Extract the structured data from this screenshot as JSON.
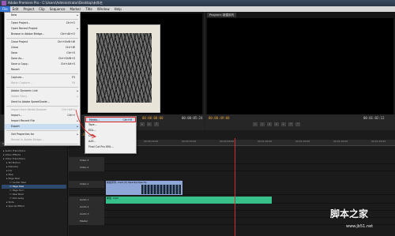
{
  "window": {
    "title": "Adobe Premiere Pro - C:\\Users\\Administrator\\Desktop\\未命名"
  },
  "menubar": {
    "items": [
      "File",
      "Edit",
      "Project",
      "Clip",
      "Sequence",
      "Marker",
      "Title",
      "Window",
      "Help"
    ]
  },
  "file_menu": {
    "items": [
      {
        "label": "New",
        "shortcut": "",
        "submenu": true,
        "disabled": false
      },
      {
        "label": "Open Project...",
        "shortcut": "Ctrl+O",
        "submenu": false,
        "disabled": false
      },
      {
        "label": "Open Recent Project",
        "shortcut": "",
        "submenu": true,
        "disabled": false
      },
      {
        "label": "Browse in Adobe Bridge...",
        "shortcut": "Ctrl+Alt+O",
        "submenu": false,
        "disabled": false
      },
      {
        "label": "Close Project",
        "shortcut": "Ctrl+Shift+W",
        "submenu": false,
        "disabled": false
      },
      {
        "label": "Close",
        "shortcut": "Ctrl+W",
        "submenu": false,
        "disabled": false
      },
      {
        "label": "Save",
        "shortcut": "Ctrl+S",
        "submenu": false,
        "disabled": false
      },
      {
        "label": "Save As...",
        "shortcut": "Ctrl+Shift+S",
        "submenu": false,
        "disabled": false
      },
      {
        "label": "Save a Copy...",
        "shortcut": "Ctrl+Alt+S",
        "submenu": false,
        "disabled": false
      },
      {
        "label": "Revert",
        "shortcut": "",
        "submenu": false,
        "disabled": false
      },
      {
        "label": "Capture...",
        "shortcut": "F5",
        "submenu": false,
        "disabled": false
      },
      {
        "label": "Batch Capture...",
        "shortcut": "F6",
        "submenu": false,
        "disabled": true
      },
      {
        "label": "Adobe Dynamic Link",
        "shortcut": "",
        "submenu": true,
        "disabled": false
      },
      {
        "label": "Adobe Story",
        "shortcut": "",
        "submenu": true,
        "disabled": true
      },
      {
        "label": "Send to Adobe SpeedGrade...",
        "shortcut": "",
        "submenu": false,
        "disabled": false
      },
      {
        "label": "Import from Media Browser",
        "shortcut": "Ctrl+Alt+I",
        "submenu": false,
        "disabled": true
      },
      {
        "label": "Import...",
        "shortcut": "Ctrl+I",
        "submenu": false,
        "disabled": false
      },
      {
        "label": "Import Recent File",
        "shortcut": "",
        "submenu": true,
        "disabled": false
      },
      {
        "label": "Export",
        "shortcut": "",
        "submenu": true,
        "disabled": false,
        "highlight": true
      },
      {
        "label": "Get Properties for",
        "shortcut": "",
        "submenu": true,
        "disabled": false
      },
      {
        "label": "Reveal in Adobe Bridge...",
        "shortcut": "",
        "submenu": false,
        "disabled": true
      },
      {
        "label": "Exit",
        "shortcut": "Ctrl+Q",
        "submenu": false,
        "disabled": false
      }
    ]
  },
  "export_submenu": {
    "items": [
      {
        "label": "Media...",
        "shortcut": "Ctrl+M",
        "highlight": true
      },
      {
        "label": "Tape...",
        "shortcut": ""
      },
      {
        "label": "EDL...",
        "shortcut": ""
      },
      {
        "label": "OMF...",
        "shortcut": ""
      },
      {
        "label": "AAF...",
        "shortcut": ""
      },
      {
        "label": "Final Cut Pro XML...",
        "shortcut": ""
      }
    ]
  },
  "source_monitor": {
    "timecode_left": "00:00:00:00",
    "timecode_right": "00:00:05:24"
  },
  "program_monitor": {
    "tab": "Program: 新建序列",
    "timecode_left": "00:00:49:08",
    "timecode_right": "00:01:02:12"
  },
  "project_panel": {
    "tabs": [
      "Media Browser",
      "Info",
      "Effects"
    ],
    "tree": [
      {
        "label": "Audio Transitions",
        "selected": false
      },
      {
        "label": "Video Effects",
        "selected": false
      },
      {
        "label": "Video Transitions",
        "selected": false
      },
      {
        "label": "3D Motion",
        "selected": false
      },
      {
        "label": "Dissolve",
        "selected": false
      },
      {
        "label": "Iris",
        "selected": false
      },
      {
        "label": "Map",
        "selected": false
      },
      {
        "label": "Page Peel",
        "selected": false
      },
      {
        "label": "Center Peel",
        "selected": false
      },
      {
        "label": "Page Peel",
        "selected": true
      },
      {
        "label": "Page Turn",
        "selected": false
      },
      {
        "label": "Peel Back",
        "selected": false
      },
      {
        "label": "Roll Away",
        "selected": false
      },
      {
        "label": "Slide",
        "selected": false
      },
      {
        "label": "Special Effect",
        "selected": false
      }
    ]
  },
  "timeline": {
    "timecode": "00:00:49:08",
    "ruler": [
      "00:00",
      "00:00:16:00",
      "00:00:32:00",
      "00:00:48:00",
      "00:01:04:00",
      "00:01:20:00",
      "00:01:36:00",
      "00:01:52:00"
    ],
    "tracks": [
      {
        "name": "Video 3"
      },
      {
        "name": "Video 2"
      },
      {
        "name": "Video 1"
      },
      {
        "name": "Audio 1"
      },
      {
        "name": "Audio 2"
      },
      {
        "name": "Audio 3"
      },
      {
        "name": "Master"
      }
    ],
    "video_clip_label": "新建序列 .mp4 [V] Opacity:Opacity",
    "audio_clip_label": "新建 .mp4"
  },
  "watermark": {
    "main": "脚本之家",
    "url": "jb51.net",
    "sub": "www.jb51.net"
  },
  "colors": {
    "accent": "#3875d7",
    "video_clip": "#8fa6d8",
    "audio_clip": "#38c08a",
    "playhead": "#d03030",
    "timecode": "#e8a33d"
  }
}
